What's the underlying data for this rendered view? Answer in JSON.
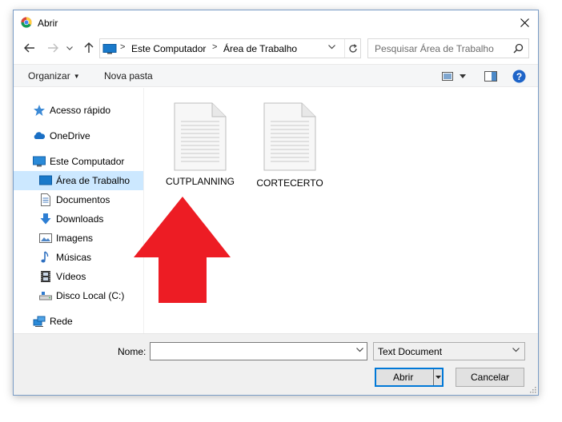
{
  "window": {
    "title": "Abrir",
    "app_icon": "chrome-icon"
  },
  "nav_buttons": {
    "back": "back-arrow-icon",
    "forward": "forward-arrow-icon",
    "recent": "chevron-down-icon",
    "up": "up-arrow-icon"
  },
  "address": {
    "crumbs": [
      "Este Computador",
      "Área de Trabalho"
    ]
  },
  "search": {
    "placeholder": "Pesquisar Área de Trabalho"
  },
  "toolbar": {
    "organize": "Organizar",
    "new_folder": "Nova pasta"
  },
  "sidebar": {
    "items": [
      {
        "label": "Acesso rápido",
        "icon": "star-icon"
      },
      {
        "label": "OneDrive",
        "icon": "cloud-icon"
      },
      {
        "label": "Este Computador",
        "icon": "monitor-icon"
      },
      {
        "label": "Área de Trabalho",
        "icon": "desktop-icon",
        "selected": true
      },
      {
        "label": "Documentos",
        "icon": "document-icon"
      },
      {
        "label": "Downloads",
        "icon": "download-icon"
      },
      {
        "label": "Imagens",
        "icon": "picture-icon"
      },
      {
        "label": "Músicas",
        "icon": "music-icon"
      },
      {
        "label": "Vídeos",
        "icon": "film-icon"
      },
      {
        "label": "Disco Local (C:)",
        "icon": "drive-icon"
      },
      {
        "label": "Rede",
        "icon": "network-icon"
      }
    ]
  },
  "files": [
    {
      "name": "CUTPLANNING",
      "icon": "text-file-icon"
    },
    {
      "name": "CORTECERTO",
      "icon": "text-file-icon"
    }
  ],
  "annotation": {
    "shape": "red-up-arrow",
    "color": "#ed1c24"
  },
  "footer": {
    "filename_label": "Nome:",
    "filename_value": "",
    "filetype": "Text Document",
    "open_label": "Abrir",
    "cancel_label": "Cancelar"
  },
  "colors": {
    "selection": "#cce8ff",
    "accent": "#0078d7",
    "arrow": "#ed1c24"
  }
}
